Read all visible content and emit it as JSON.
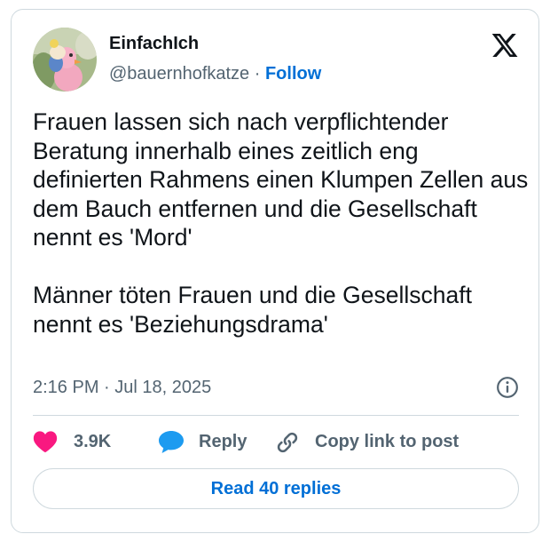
{
  "author": {
    "display_name": "EinfachIch",
    "handle": "@bauernhofkatze",
    "separator": " · ",
    "follow_label": "Follow"
  },
  "tweet": {
    "text": "Frauen lassen sich nach verpflichtender Beratung innerhalb eines zeitlich eng definierten Rahmens einen Klumpen Zellen aus dem Bauch entfernen und die Gesellschaft nennt es 'Mord'\n\nMänner töten Frauen und die Gesellschaft nennt es 'Beziehungsdrama'",
    "time": "2:16 PM",
    "date_separator": " · ",
    "date": "Jul 18, 2025"
  },
  "actions": {
    "like_count": "3.9K",
    "reply_label": "Reply",
    "copy_link_label": "Copy link to post"
  },
  "read_replies_label": "Read 40 replies",
  "icons": {
    "like": "heart-icon",
    "reply": "speech-bubble-icon",
    "copy_link": "link-icon",
    "info": "info-icon",
    "brand": "x-logo-icon"
  },
  "colors": {
    "heart": "#f91880",
    "reply_bubble": "#1d9bf0",
    "link_blue": "#006fd6",
    "secondary_text": "#536471",
    "border": "#cfd9de"
  }
}
